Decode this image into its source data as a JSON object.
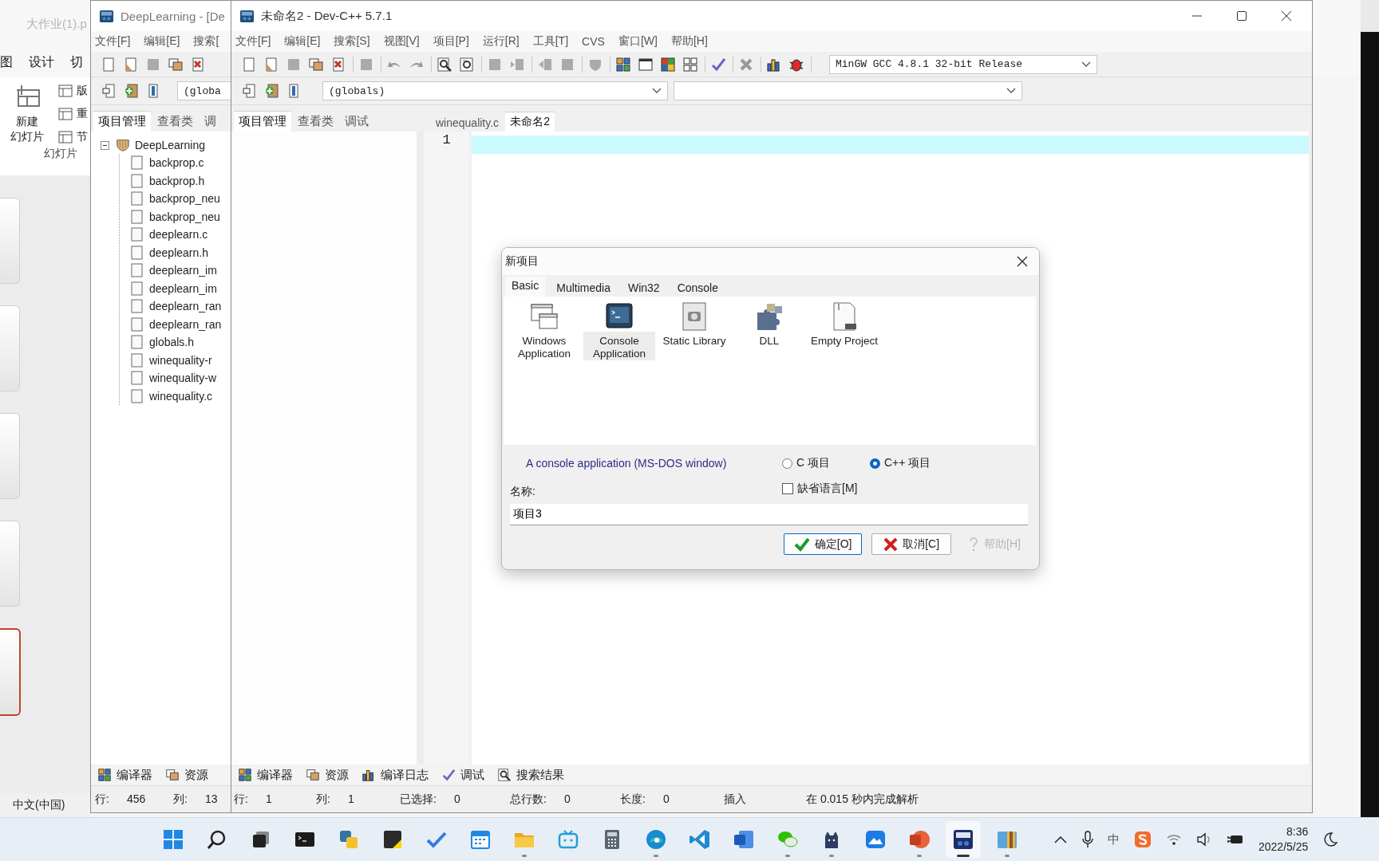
{
  "ppt_window": {
    "title": "大作业(1).p",
    "ribbon_tabs": [
      "图",
      "设计",
      "切"
    ],
    "new_slide_lines": [
      "新建",
      "幻灯片"
    ],
    "ribbon_items": [
      "版",
      "重",
      "节"
    ],
    "group_label": "幻灯片",
    "slides": [
      {
        "selected": false
      },
      {
        "selected": false
      },
      {
        "selected": false
      },
      {
        "selected": false
      },
      {
        "selected": true
      }
    ],
    "status": "中文(中国)"
  },
  "project_window": {
    "title": "DeepLearning - [De",
    "menu": [
      "文件[F]",
      "编辑[E]",
      "搜索["
    ],
    "scope_combo": "(globa",
    "tabs": [
      {
        "label": "项目管理",
        "selected": true
      },
      {
        "label": "查看类",
        "selected": false
      },
      {
        "label": "调",
        "selected": false
      }
    ],
    "tree": {
      "label": "DeepLearning",
      "expanded": true,
      "children": [
        {
          "label": "backprop.c"
        },
        {
          "label": "backprop.h"
        },
        {
          "label": "backprop_neu"
        },
        {
          "label": "backprop_neu"
        },
        {
          "label": "deeplearn.c"
        },
        {
          "label": "deeplearn.h"
        },
        {
          "label": "deeplearn_im"
        },
        {
          "label": "deeplearn_im"
        },
        {
          "label": "deeplearn_ran"
        },
        {
          "label": "deeplearn_ran"
        },
        {
          "label": "globals.h"
        },
        {
          "label": "winequality-r"
        },
        {
          "label": "winequality-w"
        },
        {
          "label": "winequality.c"
        }
      ]
    },
    "bottom_tabs": [
      {
        "label": "编译器",
        "kind": "compiler"
      },
      {
        "label": "资源",
        "kind": "resources"
      }
    ],
    "status": [
      {
        "label": "行:",
        "value": "456"
      },
      {
        "label": "列:",
        "value": "13"
      }
    ]
  },
  "ide_window": {
    "title": "未命名2 - Dev-C++ 5.7.1",
    "menu": [
      "文件[F]",
      "编辑[E]",
      "搜索[S]",
      "视图[V]",
      "项目[P]",
      "运行[R]",
      "工具[T]",
      "CVS",
      "窗口[W]",
      "帮助[H]"
    ],
    "compiler": "MinGW GCC 4.8.1 32-bit Release",
    "scope_combo": "(globals)",
    "left_tabs": [
      {
        "label": "项目管理",
        "selected": true
      },
      {
        "label": "查看类",
        "selected": false
      },
      {
        "label": "调试",
        "selected": false
      }
    ],
    "editor_tabs": [
      {
        "label": "winequality.c",
        "selected": false
      },
      {
        "label": "未命名2",
        "selected": true
      }
    ],
    "line_numbers": [
      "1"
    ],
    "bottom_tabs": [
      {
        "label": "编译器",
        "kind": "compiler"
      },
      {
        "label": "资源",
        "kind": "resources"
      },
      {
        "label": "编译日志",
        "kind": "log"
      },
      {
        "label": "调试",
        "kind": "debug"
      },
      {
        "label": "搜索结果",
        "kind": "search"
      }
    ],
    "status": [
      {
        "label": "行:",
        "value": "1"
      },
      {
        "label": "列:",
        "value": "1"
      },
      {
        "label": "已选择:",
        "value": "0"
      },
      {
        "label": "总行数:",
        "value": "0"
      },
      {
        "label": "长度:",
        "value": "0"
      },
      {
        "label": "插入"
      },
      {
        "label": "在 0.015 秒内完成解析"
      }
    ]
  },
  "dialog": {
    "title": "新项目",
    "tabs": [
      {
        "label": "Basic",
        "selected": true
      },
      {
        "label": "Multimedia",
        "selected": false
      },
      {
        "label": "Win32",
        "selected": false
      },
      {
        "label": "Console",
        "selected": false
      }
    ],
    "templates": [
      {
        "kind": "windows",
        "label": "Windows Application",
        "selected": false
      },
      {
        "kind": "console",
        "label": "Console Application",
        "selected": true
      },
      {
        "kind": "library",
        "label": "Static Library",
        "selected": false
      },
      {
        "kind": "dll",
        "label": "DLL",
        "selected": false
      },
      {
        "kind": "empty",
        "label": "Empty Project",
        "selected": false
      }
    ],
    "description": "A console application (MS-DOS window)",
    "languages": [
      {
        "label": "C 项目",
        "selected": false
      },
      {
        "label": "C++ 项目",
        "selected": true
      }
    ],
    "default_language": {
      "label": "缺省语言[M]",
      "checked": false
    },
    "name_label": "名称:",
    "name_value": "项目3",
    "buttons": [
      {
        "kind": "ok",
        "label": "确定[O]",
        "disabled": false
      },
      {
        "kind": "cancel",
        "label": "取消[C]",
        "disabled": false
      },
      {
        "kind": "help",
        "label": "帮助[H]",
        "disabled": true
      }
    ]
  },
  "taskbar": {
    "apps": [
      {
        "kind": "start",
        "running": false,
        "active": false
      },
      {
        "kind": "search",
        "running": false,
        "active": false
      },
      {
        "kind": "taskview",
        "running": false,
        "active": false
      },
      {
        "kind": "terminal",
        "running": false,
        "active": false
      },
      {
        "kind": "python",
        "running": false,
        "active": false
      },
      {
        "kind": "notes",
        "running": false,
        "active": false
      },
      {
        "kind": "todo",
        "running": false,
        "active": false
      },
      {
        "kind": "calendar",
        "running": false,
        "active": false
      },
      {
        "kind": "explorer",
        "running": true,
        "active": false
      },
      {
        "kind": "tv",
        "running": false,
        "active": false
      },
      {
        "kind": "calculator",
        "running": false,
        "active": false
      },
      {
        "kind": "browser",
        "running": true,
        "active": false
      },
      {
        "kind": "editor",
        "running": false,
        "active": false
      },
      {
        "kind": "word",
        "running": false,
        "active": false
      },
      {
        "kind": "chat",
        "running": true,
        "active": false
      },
      {
        "kind": "cat",
        "running": true,
        "active": false
      },
      {
        "kind": "cloud",
        "running": false,
        "active": false
      },
      {
        "kind": "slides",
        "running": true,
        "active": false
      },
      {
        "kind": "devcpp",
        "running": true,
        "active": true
      },
      {
        "kind": "archive",
        "running": true,
        "active": false
      }
    ],
    "ime": "中",
    "time": "8:36",
    "date": "2022/5/25"
  }
}
